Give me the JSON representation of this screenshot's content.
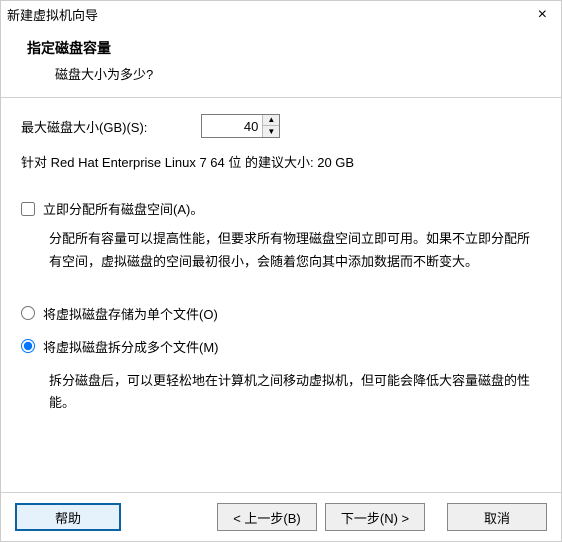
{
  "window": {
    "title": "新建虚拟机向导"
  },
  "header": {
    "title": "指定磁盘容量",
    "subtitle": "磁盘大小为多少?"
  },
  "disk": {
    "label": "最大磁盘大小(GB)(S):",
    "value": "40",
    "recommendation": "针对 Red Hat Enterprise Linux 7 64 位 的建议大小: 20 GB"
  },
  "allocate": {
    "checkbox_label": "立即分配所有磁盘空间(A)。",
    "desc": "分配所有容量可以提高性能，但要求所有物理磁盘空间立即可用。如果不立即分配所有空间，虚拟磁盘的空间最初很小，会随着您向其中添加数据而不断变大。"
  },
  "storage": {
    "single_label": "将虚拟磁盘存储为单个文件(O)",
    "split_label": "将虚拟磁盘拆分成多个文件(M)",
    "split_desc": "拆分磁盘后，可以更轻松地在计算机之间移动虚拟机，但可能会降低大容量磁盘的性能。"
  },
  "buttons": {
    "help": "帮助",
    "back": "< 上一步(B)",
    "next": "下一步(N) >",
    "cancel": "取消"
  }
}
